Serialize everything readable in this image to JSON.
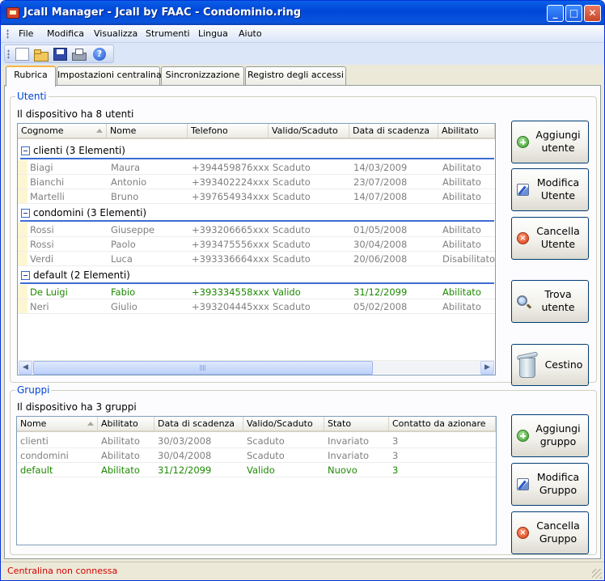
{
  "window": {
    "title": "Jcall Manager - Jcall by FAAC - Condominio.ring",
    "minimize": "_",
    "maximize": "□",
    "close": "✕"
  },
  "menu": [
    "File",
    "Modifica",
    "Visualizza",
    "Strumenti",
    "Lingua",
    "Aiuto"
  ],
  "toolbar": {
    "icons": [
      "new-document-icon",
      "open-folder-icon",
      "save-disk-icon",
      "print-icon",
      "help-icon"
    ],
    "help_glyph": "?"
  },
  "tabs": [
    "Rubrica",
    "Impostazioni centralina",
    "Sincronizzazione",
    "Registro degli accessi"
  ],
  "users": {
    "legend": "Utenti",
    "count_text": "Il dispositivo ha 8 utenti",
    "columns": [
      "Cognome",
      "Nome",
      "Telefono",
      "Valido/Scaduto",
      "Data di scadenza",
      "Abilitato"
    ],
    "groups": [
      {
        "label": "clienti (3 Elementi)",
        "rows": [
          {
            "cognome": "Biagi",
            "nome": "Maura",
            "telefono": "+394459876xxx",
            "valido": "Scaduto",
            "scadenza": "14/03/2009",
            "abilitato": "Abilitato"
          },
          {
            "cognome": "Bianchi",
            "nome": "Antonio",
            "telefono": "+393402224xxx",
            "valido": "Scaduto",
            "scadenza": "23/07/2008",
            "abilitato": "Abilitato"
          },
          {
            "cognome": "Martelli",
            "nome": "Bruno",
            "telefono": "+397654934xxx",
            "valido": "Scaduto",
            "scadenza": "14/07/2008",
            "abilitato": "Abilitato"
          }
        ]
      },
      {
        "label": "condomini (3 Elementi)",
        "rows": [
          {
            "cognome": "Rossi",
            "nome": "Giuseppe",
            "telefono": "+393206665xxx",
            "valido": "Scaduto",
            "scadenza": "01/05/2008",
            "abilitato": "Abilitato"
          },
          {
            "cognome": "Rossi",
            "nome": "Paolo",
            "telefono": "+393475556xxx",
            "valido": "Scaduto",
            "scadenza": "30/04/2008",
            "abilitato": "Abilitato"
          },
          {
            "cognome": "Verdi",
            "nome": "Luca",
            "telefono": "+393336664xxx",
            "valido": "Scaduto",
            "scadenza": "20/06/2008",
            "abilitato": "Disabilitato"
          }
        ]
      },
      {
        "label": "default (2 Elementi)",
        "rows": [
          {
            "cognome": "De Luigi",
            "nome": "Fabio",
            "telefono": "+393334558xxx",
            "valido": "Valido",
            "scadenza": "31/12/2099",
            "abilitato": "Abilitato"
          },
          {
            "cognome": "Neri",
            "nome": "Giulio",
            "telefono": "+393204445xxx",
            "valido": "Scaduto",
            "scadenza": "05/02/2008",
            "abilitato": "Abilitato"
          }
        ]
      }
    ],
    "buttons": {
      "add": [
        "Aggiungi",
        "utente"
      ],
      "edit": [
        "Modifica",
        "Utente"
      ],
      "delete": [
        "Cancella",
        "Utente"
      ],
      "find": [
        "Trova",
        "utente"
      ],
      "trash": "Cestino"
    }
  },
  "groups_section": {
    "legend": "Gruppi",
    "count_text": "Il dispositivo ha 3 gruppi",
    "columns": [
      "Nome",
      "Abilitato",
      "Data di scadenza",
      "Valido/Scaduto",
      "Stato",
      "Contatto da azionare"
    ],
    "rows": [
      {
        "nome": "clienti",
        "abilitato": "Abilitato",
        "scadenza": "30/03/2008",
        "valido": "Scaduto",
        "stato": "Invariato",
        "contatto": "3"
      },
      {
        "nome": "condomini",
        "abilitato": "Abilitato",
        "scadenza": "30/04/2008",
        "valido": "Scaduto",
        "stato": "Invariato",
        "contatto": "3"
      },
      {
        "nome": "default",
        "abilitato": "Abilitato",
        "scadenza": "31/12/2099",
        "valido": "Valido",
        "stato": "Nuovo",
        "contatto": "3"
      }
    ],
    "buttons": {
      "add": [
        "Aggiungi",
        "gruppo"
      ],
      "edit": [
        "Modifica",
        "Gruppo"
      ],
      "delete": [
        "Cancella",
        "Gruppo"
      ]
    }
  },
  "scrollbar": {
    "left_arrow": "◀",
    "right_arrow": "▶"
  },
  "status": {
    "text": "Centralina non connessa"
  },
  "colors": {
    "valid": "#1d8a00",
    "expired": "#808080",
    "status_error": "#d40000",
    "legend": "#0046d5"
  }
}
